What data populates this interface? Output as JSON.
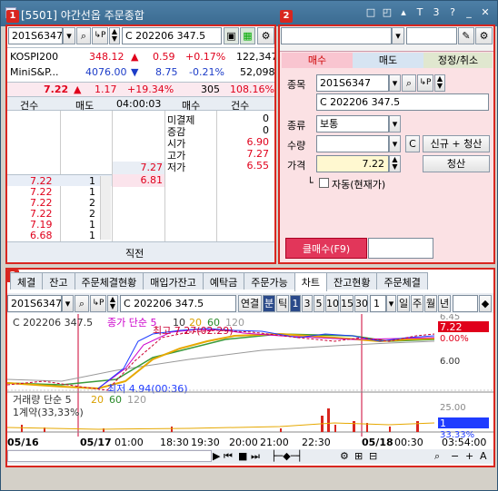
{
  "window": {
    "title": "[5501] 야간선옵 주문종합",
    "icons": [
      "□",
      "◰",
      "▴",
      "T",
      "3",
      "?",
      "_",
      "✕"
    ]
  },
  "badges": {
    "p1": "1",
    "p2": "2",
    "p3": "3"
  },
  "left": {
    "code": "201S6347",
    "code_name": "C 202206 347.5",
    "markets": [
      {
        "name": "KOSPI200",
        "price": "348.12",
        "dir": "▲",
        "chg": "0.59",
        "pct": "+0.17%",
        "vol": "122,347"
      },
      {
        "name": "MiniS&P...",
        "price": "4076.00",
        "dir": "▼",
        "chg": "8.75",
        "pct": "-0.21%",
        "vol": "52,098"
      }
    ],
    "summary": {
      "price": "7.22",
      "dir": "▲",
      "chg": "1.17",
      "pct": "+19.34%",
      "vol": "305",
      "ratio": "108.16%"
    },
    "book_headers": [
      "건수",
      "매도",
      "04:00:03",
      "매수",
      "건수"
    ],
    "info": [
      {
        "label": "미결제",
        "value": "0"
      },
      {
        "label": "증감",
        "value": "0"
      },
      {
        "label": "시가",
        "value": "6.90"
      },
      {
        "label": "고가",
        "value": "7.27"
      },
      {
        "label": "저가",
        "value": "6.55"
      }
    ],
    "ask_price": "7.27",
    "bid_price": "6.81",
    "ticks": [
      {
        "p": "7.22",
        "q": "1"
      },
      {
        "p": "7.22",
        "q": "1"
      },
      {
        "p": "7.22",
        "q": "2"
      },
      {
        "p": "7.22",
        "q": "2"
      },
      {
        "p": "7.19",
        "q": "1"
      },
      {
        "p": "6.68",
        "q": "1"
      }
    ],
    "footer": "직전"
  },
  "order": {
    "tabs": [
      "매수",
      "매도",
      "정정/취소"
    ],
    "labels": {
      "item": "종목",
      "type": "종류",
      "qty": "수량",
      "price": "가격"
    },
    "code": "201S6347",
    "code_name": "C 202206 347.5",
    "kind": "보통",
    "price": "7.22",
    "btn_c": "C",
    "btn_new": "신규 + 청산",
    "btn_close": "청산",
    "auto_label": "자동(현재가)",
    "submit": "클매수(F9)"
  },
  "bottom": {
    "tabs": [
      "체결",
      "잔고",
      "주문체결현황",
      "매입가잔고",
      "예탁금",
      "주문가능",
      "차트",
      "잔고현황",
      "주문체결"
    ],
    "active_tab": "차트",
    "code": "201S6347",
    "code_name": "C 202206 347.5",
    "periods": [
      "연결",
      "분",
      "틱",
      "1",
      "3",
      "5",
      "10",
      "15",
      "30"
    ],
    "period_select": "1",
    "units": [
      "일",
      "주",
      "월",
      "년"
    ],
    "chart": {
      "title": "C 202206 347.5",
      "ma_label": "종가 단순 5",
      "ma": [
        "10",
        "20",
        "60",
        "120"
      ],
      "high_label": "최고 7.27(02:29)",
      "low_label": "최저 4.94(00:36)",
      "price_tag": "7.22",
      "pct_tag": "0.00%",
      "top_label": "6.45",
      "mid_label": "6.00",
      "vol_title": "거래량 단순 5",
      "vol_ma": [
        "20",
        "60",
        "120"
      ],
      "vol_unit": "1계약(33,33%)",
      "vol_tag": "1",
      "vol_pct": "33.33%",
      "vol_top": "25.00",
      "xaxis": [
        "05/16",
        "05/17",
        "01:00",
        "18:30",
        "19:30",
        "20:00",
        "21:00",
        "22:30",
        "05/18",
        "00:30",
        "03:54:00"
      ]
    }
  }
}
